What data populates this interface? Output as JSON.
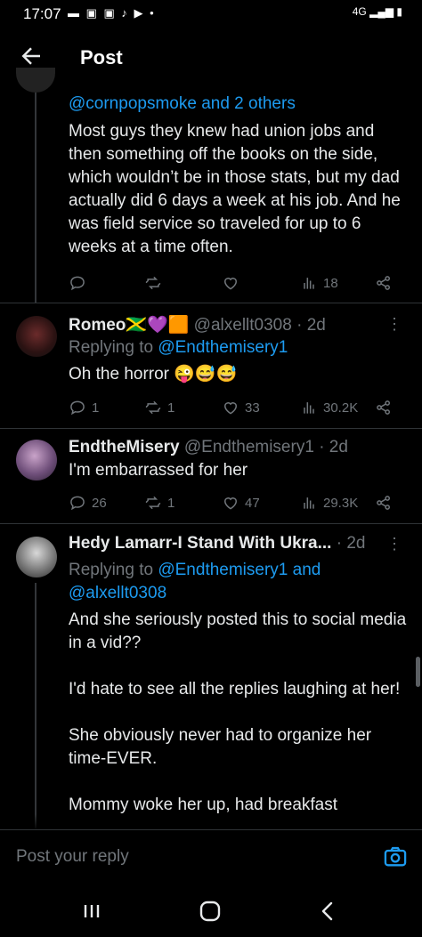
{
  "status_bar": {
    "time": "17:07",
    "network": "4G"
  },
  "header": {
    "title": "Post"
  },
  "tweets": [
    {
      "continued_handles": "@cornpopsmoke and 2 others",
      "text": "Most guys they knew had union jobs and then something off the books on the side, which wouldn’t be in those stats, but my dad actually did 6 days a week at his job. And he was field service so traveled for up to 6 weeks at a time often.",
      "views": "18"
    },
    {
      "display_name": "Romeo",
      "name_emoji": "🇯🇲💜🟧",
      "handle": "@alxellt0308",
      "time": "· 2d",
      "replying_prefix": "Replying to ",
      "replying_to": "@Endthemisery1",
      "text": "Oh the horror 😜😅😅",
      "replies": "1",
      "reposts": "1",
      "likes": "33",
      "views": "30.2K"
    },
    {
      "display_name": "EndtheMisery",
      "handle": "@Endthemisery1",
      "time": "· 2d",
      "text": "I'm embarrassed for her",
      "replies": "26",
      "reposts": "1",
      "likes": "47",
      "views": "29.3K"
    },
    {
      "display_name": "Hedy Lamarr-I Stand With Ukra...",
      "time": "· 2d",
      "replying_prefix": "Replying to ",
      "replying_to": "@Endthemisery1",
      "replying_and": " and",
      "replying_to_2": "@alxellt0308",
      "text": "And she seriously posted this to social media in a vid??\n\nI'd hate to see all the replies laughing at her!\n\nShe obviously never had to organize her time-EVER.\n\nMommy woke her up, had breakfast"
    }
  ],
  "reply_bar": {
    "placeholder": "Post your reply"
  },
  "colors": {
    "accent": "#1d9bf0",
    "muted": "#71767b",
    "background": "#000000"
  }
}
